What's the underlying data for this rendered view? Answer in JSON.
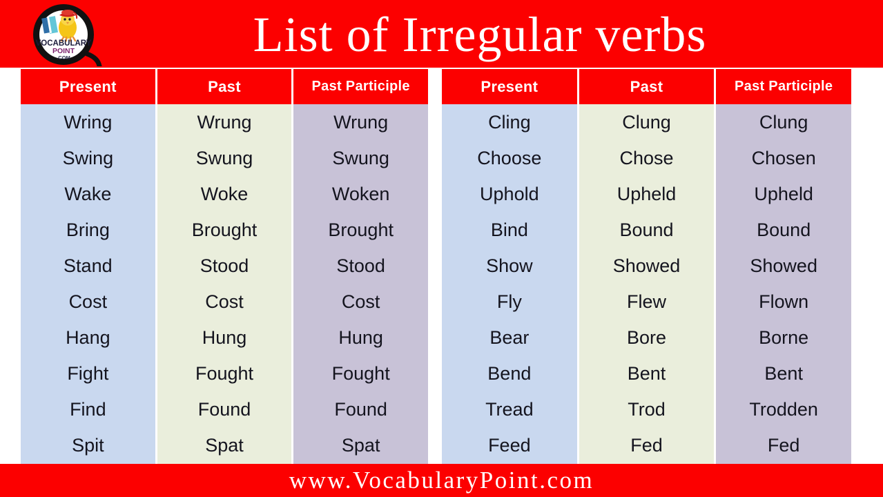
{
  "header": {
    "title": "List of Irregular verbs",
    "background_color": "#fc0000",
    "title_color": "#ffffff"
  },
  "logo": {
    "name": "vocabulary-point-logo",
    "line1": "VOCABULARY",
    "line2": "POINT",
    "line3": ".COM"
  },
  "footer": {
    "url": "www.VocabularyPoint.com",
    "background_color": "#fc0000",
    "text_color": "#ffffff"
  },
  "colors": {
    "accent_red": "#fc0000",
    "col1_bg": "#c9d8ef",
    "col2_bg": "#eaeedc",
    "col3_bg": "#c8c2d7",
    "cell_text": "#14141e"
  },
  "tables": [
    {
      "id": "left-table",
      "headers": [
        "Present",
        "Past",
        "Past Participle"
      ],
      "rows": [
        [
          "Wring",
          "Wrung",
          "Wrung"
        ],
        [
          "Swing",
          "Swung",
          "Swung"
        ],
        [
          "Wake",
          "Woke",
          "Woken"
        ],
        [
          "Bring",
          "Brought",
          "Brought"
        ],
        [
          "Stand",
          "Stood",
          "Stood"
        ],
        [
          "Cost",
          "Cost",
          "Cost"
        ],
        [
          "Hang",
          "Hung",
          "Hung"
        ],
        [
          "Fight",
          "Fought",
          "Fought"
        ],
        [
          "Find",
          "Found",
          "Found"
        ],
        [
          "Spit",
          "Spat",
          "Spat"
        ]
      ]
    },
    {
      "id": "right-table",
      "headers": [
        "Present",
        "Past",
        "Past Participle"
      ],
      "rows": [
        [
          "Cling",
          "Clung",
          "Clung"
        ],
        [
          "Choose",
          "Chose",
          "Chosen"
        ],
        [
          "Uphold",
          "Upheld",
          "Upheld"
        ],
        [
          "Bind",
          "Bound",
          "Bound"
        ],
        [
          "Show",
          "Showed",
          "Showed"
        ],
        [
          "Fly",
          "Flew",
          "Flown"
        ],
        [
          "Bear",
          "Bore",
          "Borne"
        ],
        [
          "Bend",
          "Bent",
          "Bent"
        ],
        [
          "Tread",
          "Trod",
          "Trodden"
        ],
        [
          "Feed",
          "Fed",
          "Fed"
        ]
      ]
    }
  ]
}
